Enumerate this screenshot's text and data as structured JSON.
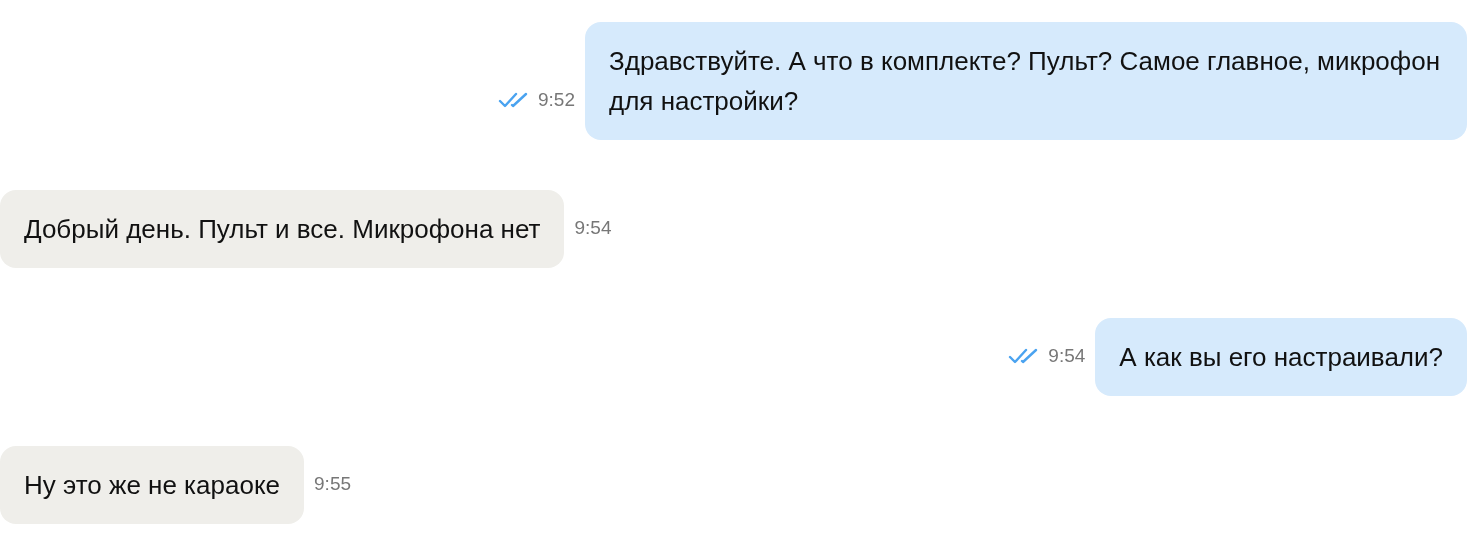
{
  "messages": [
    {
      "kind": "outgoing",
      "text": "Здравствуйте. А что в комплекте? Пульт? Самое главное, микрофон для настройки?",
      "time": "9:52",
      "read": true
    },
    {
      "kind": "incoming",
      "text": "Добрый день. Пульт и все. Микрофона нет",
      "time": "9:54"
    },
    {
      "kind": "outgoing",
      "text": "А как вы его настраивали?",
      "time": "9:54",
      "read": true
    },
    {
      "kind": "incoming",
      "text": "Ну это же не караоке",
      "time": "9:55"
    }
  ]
}
